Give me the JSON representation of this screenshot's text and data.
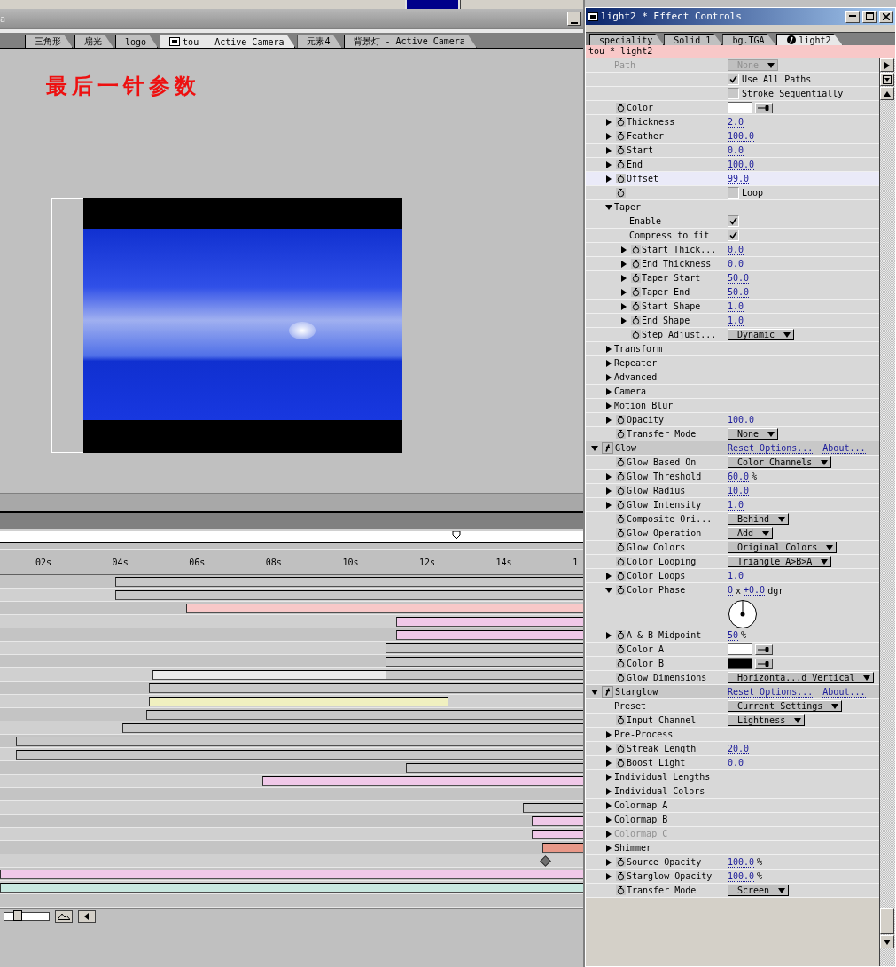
{
  "comp_window": {
    "title": "a",
    "tabs": [
      {
        "label": "三角形",
        "selected": false
      },
      {
        "label": "扇光",
        "selected": false
      },
      {
        "label": "logo",
        "selected": false
      },
      {
        "label": "tou - Active Camera",
        "selected": true
      },
      {
        "label": "元素4",
        "selected": false
      },
      {
        "label": "背景灯 - Active Camera",
        "selected": false
      }
    ],
    "caption": "最后一针参数"
  },
  "timeline": {
    "ruler_labels": [
      "02s",
      "04s",
      "06s",
      "08s",
      "10s",
      "12s",
      "14s",
      "1"
    ],
    "zoom_slider": {
      "level": 0.25
    }
  },
  "effect_controls": {
    "title": "light2 * Effect Controls",
    "tabs": [
      {
        "label": "speciality",
        "selected": false
      },
      {
        "label": "Solid 1",
        "selected": false
      },
      {
        "label": "bg.TGA",
        "selected": false
      },
      {
        "label": "light2",
        "selected": true
      }
    ],
    "layer_header": "tou * light2",
    "rows": [
      {
        "kind": "dropdown",
        "label": "Path",
        "stopwatch": false,
        "selected": false,
        "disabled": true,
        "value": "None"
      },
      {
        "kind": "checkbox",
        "stopwatch": false,
        "selected": false,
        "disabled": false,
        "checked": true,
        "text": "Use All Paths"
      },
      {
        "kind": "checkbox",
        "stopwatch": false,
        "selected": false,
        "disabled": false,
        "checked": false,
        "text": "Stroke Sequentially"
      },
      {
        "kind": "color",
        "label": "Color",
        "stopwatch": true,
        "selected": false,
        "disabled": false,
        "color": "#ffffff"
      },
      {
        "kind": "value",
        "label": "Thickness",
        "expanded": false,
        "stopwatch": true,
        "selected": false,
        "disabled": false,
        "value": "2.0"
      },
      {
        "kind": "value",
        "label": "Feather",
        "expanded": false,
        "stopwatch": true,
        "selected": false,
        "disabled": false,
        "value": "100.0"
      },
      {
        "kind": "value",
        "label": "Start",
        "expanded": false,
        "stopwatch": true,
        "selected": false,
        "disabled": false,
        "value": "0.0"
      },
      {
        "kind": "value",
        "label": "End",
        "expanded": false,
        "stopwatch": true,
        "selected": false,
        "disabled": false,
        "value": "100.0"
      },
      {
        "kind": "value",
        "label": "Offset",
        "expanded": false,
        "stopwatch": true,
        "selected": true,
        "disabled": false,
        "value": "99.0"
      },
      {
        "kind": "checkbox",
        "stopwatch": true,
        "selected": false,
        "disabled": false,
        "checked": false,
        "text": "Loop"
      },
      {
        "kind": "group",
        "label": "Taper",
        "expanded": true,
        "stopwatch": false,
        "selected": false,
        "disabled": false,
        "children": [
          {
            "kind": "checkbox",
            "label": "Enable",
            "stopwatch": false,
            "selected": false,
            "disabled": false,
            "checked": true
          },
          {
            "kind": "checkbox",
            "label": "Compress to fit",
            "stopwatch": false,
            "selected": false,
            "disabled": false,
            "checked": true
          },
          {
            "kind": "value",
            "label": "Start Thick...",
            "expanded": false,
            "stopwatch": true,
            "selected": false,
            "disabled": false,
            "value": "0.0"
          },
          {
            "kind": "value",
            "label": "End Thickness",
            "expanded": false,
            "stopwatch": true,
            "selected": false,
            "disabled": false,
            "value": "0.0"
          },
          {
            "kind": "value",
            "label": "Taper Start",
            "expanded": false,
            "stopwatch": true,
            "selected": false,
            "disabled": false,
            "value": "50.0"
          },
          {
            "kind": "value",
            "label": "Taper End",
            "expanded": false,
            "stopwatch": true,
            "selected": false,
            "disabled": false,
            "value": "50.0"
          },
          {
            "kind": "value",
            "label": "Start Shape",
            "expanded": false,
            "stopwatch": true,
            "selected": false,
            "disabled": false,
            "value": "1.0"
          },
          {
            "kind": "value",
            "label": "End Shape",
            "expanded": false,
            "stopwatch": true,
            "selected": false,
            "disabled": false,
            "value": "1.0"
          },
          {
            "kind": "dropdown",
            "label": "Step Adjust...",
            "stopwatch": true,
            "selected": false,
            "disabled": false,
            "value": "Dynamic"
          }
        ]
      },
      {
        "kind": "group",
        "label": "Transform",
        "expanded": false,
        "stopwatch": false,
        "selected": false,
        "disabled": false
      },
      {
        "kind": "group",
        "label": "Repeater",
        "expanded": false,
        "stopwatch": false,
        "selected": false,
        "disabled": false
      },
      {
        "kind": "group",
        "label": "Advanced",
        "expanded": false,
        "stopwatch": false,
        "selected": false,
        "disabled": false
      },
      {
        "kind": "group",
        "label": "Camera",
        "expanded": false,
        "stopwatch": false,
        "selected": false,
        "disabled": false
      },
      {
        "kind": "group",
        "label": "Motion Blur",
        "expanded": false,
        "stopwatch": false,
        "selected": false,
        "disabled": false
      },
      {
        "kind": "value",
        "label": "Opacity",
        "expanded": false,
        "stopwatch": true,
        "selected": false,
        "disabled": false,
        "value": "100.0"
      },
      {
        "kind": "dropdown",
        "label": "Transfer Mode",
        "stopwatch": true,
        "selected": false,
        "disabled": false,
        "value": "None"
      },
      {
        "kind": "effect",
        "label": "Glow",
        "expanded": true,
        "selected": false,
        "disabled": false,
        "links": [
          "Reset Options...",
          "About..."
        ],
        "children": [
          {
            "kind": "dropdown",
            "label": "Glow Based On",
            "stopwatch": true,
            "selected": false,
            "disabled": false,
            "value": "Color Channels"
          },
          {
            "kind": "value",
            "label": "Glow Threshold",
            "expanded": false,
            "stopwatch": true,
            "selected": false,
            "disabled": false,
            "value": "60.0",
            "unit": "%"
          },
          {
            "kind": "value",
            "label": "Glow Radius",
            "expanded": false,
            "stopwatch": true,
            "selected": false,
            "disabled": false,
            "value": "10.0"
          },
          {
            "kind": "value",
            "label": "Glow Intensity",
            "expanded": false,
            "stopwatch": true,
            "selected": false,
            "disabled": false,
            "value": "1.0"
          },
          {
            "kind": "dropdown",
            "label": "Composite Ori...",
            "stopwatch": true,
            "selected": false,
            "disabled": false,
            "value": "Behind"
          },
          {
            "kind": "dropdown",
            "label": "Glow Operation",
            "stopwatch": true,
            "selected": false,
            "disabled": false,
            "value": "Add"
          },
          {
            "kind": "dropdown",
            "label": "Glow Colors",
            "stopwatch": true,
            "selected": false,
            "disabled": false,
            "value": "Original Colors"
          },
          {
            "kind": "dropdown",
            "label": "Color Looping",
            "stopwatch": true,
            "selected": false,
            "disabled": false,
            "value": "Triangle A>B>A"
          },
          {
            "kind": "value",
            "label": "Color Loops",
            "expanded": false,
            "stopwatch": true,
            "selected": false,
            "disabled": false,
            "value": "1.0"
          },
          {
            "kind": "angle",
            "label": "Color Phase",
            "expanded": true,
            "stopwatch": true,
            "selected": false,
            "disabled": false,
            "value": "0",
            "separator": "x",
            "value_2": "+0.0",
            "unit": "dgr"
          },
          {
            "kind": "value",
            "label": "A & B Midpoint",
            "expanded": false,
            "stopwatch": true,
            "selected": false,
            "disabled": false,
            "value": "50",
            "unit": "%"
          },
          {
            "kind": "color",
            "label": "Color A",
            "stopwatch": true,
            "selected": false,
            "disabled": false,
            "color": "#ffffff"
          },
          {
            "kind": "color",
            "label": "Color B",
            "stopwatch": true,
            "selected": false,
            "disabled": false,
            "color": "#000000"
          },
          {
            "kind": "dropdown",
            "label": "Glow Dimensions",
            "stopwatch": true,
            "selected": false,
            "disabled": false,
            "value": "Horizonta...d Vertical"
          }
        ]
      },
      {
        "kind": "effect",
        "label": "Starglow",
        "expanded": true,
        "selected": false,
        "disabled": false,
        "links": [
          "Reset Options...",
          "About..."
        ],
        "children": [
          {
            "kind": "dropdown",
            "label": "Preset",
            "stopwatch": false,
            "selected": false,
            "disabled": false,
            "value": "Current Settings"
          },
          {
            "kind": "dropdown",
            "label": "Input Channel",
            "stopwatch": true,
            "selected": false,
            "disabled": false,
            "value": "Lightness"
          },
          {
            "kind": "group",
            "label": "Pre-Process",
            "expanded": false,
            "stopwatch": false,
            "selected": false,
            "disabled": false
          },
          {
            "kind": "value",
            "label": "Streak Length",
            "expanded": false,
            "stopwatch": true,
            "selected": false,
            "disabled": false,
            "value": "20.0"
          },
          {
            "kind": "value",
            "label": "Boost Light",
            "expanded": false,
            "stopwatch": true,
            "selected": false,
            "disabled": false,
            "value": "0.0"
          },
          {
            "kind": "group",
            "label": "Individual Lengths",
            "expanded": false,
            "stopwatch": false,
            "selected": false,
            "disabled": false
          },
          {
            "kind": "group",
            "label": "Individual Colors",
            "expanded": false,
            "stopwatch": false,
            "selected": false,
            "disabled": false
          },
          {
            "kind": "group",
            "label": "Colormap A",
            "expanded": false,
            "stopwatch": false,
            "selected": false,
            "disabled": false
          },
          {
            "kind": "group",
            "label": "Colormap B",
            "expanded": false,
            "stopwatch": false,
            "selected": false,
            "disabled": false
          },
          {
            "kind": "group",
            "label": "Colormap C",
            "expanded": false,
            "stopwatch": false,
            "selected": false,
            "disabled": true
          },
          {
            "kind": "group",
            "label": "Shimmer",
            "expanded": false,
            "stopwatch": false,
            "selected": false,
            "disabled": false
          },
          {
            "kind": "value",
            "label": "Source Opacity",
            "expanded": false,
            "stopwatch": true,
            "selected": false,
            "disabled": false,
            "value": "100.0",
            "unit": "%"
          },
          {
            "kind": "value",
            "label": "Starglow Opacity",
            "expanded": false,
            "stopwatch": true,
            "selected": false,
            "disabled": false,
            "value": "100.0",
            "unit": "%"
          },
          {
            "kind": "dropdown",
            "label": "Transfer Mode",
            "stopwatch": true,
            "selected": false,
            "disabled": false,
            "value": "Screen"
          }
        ]
      }
    ]
  }
}
